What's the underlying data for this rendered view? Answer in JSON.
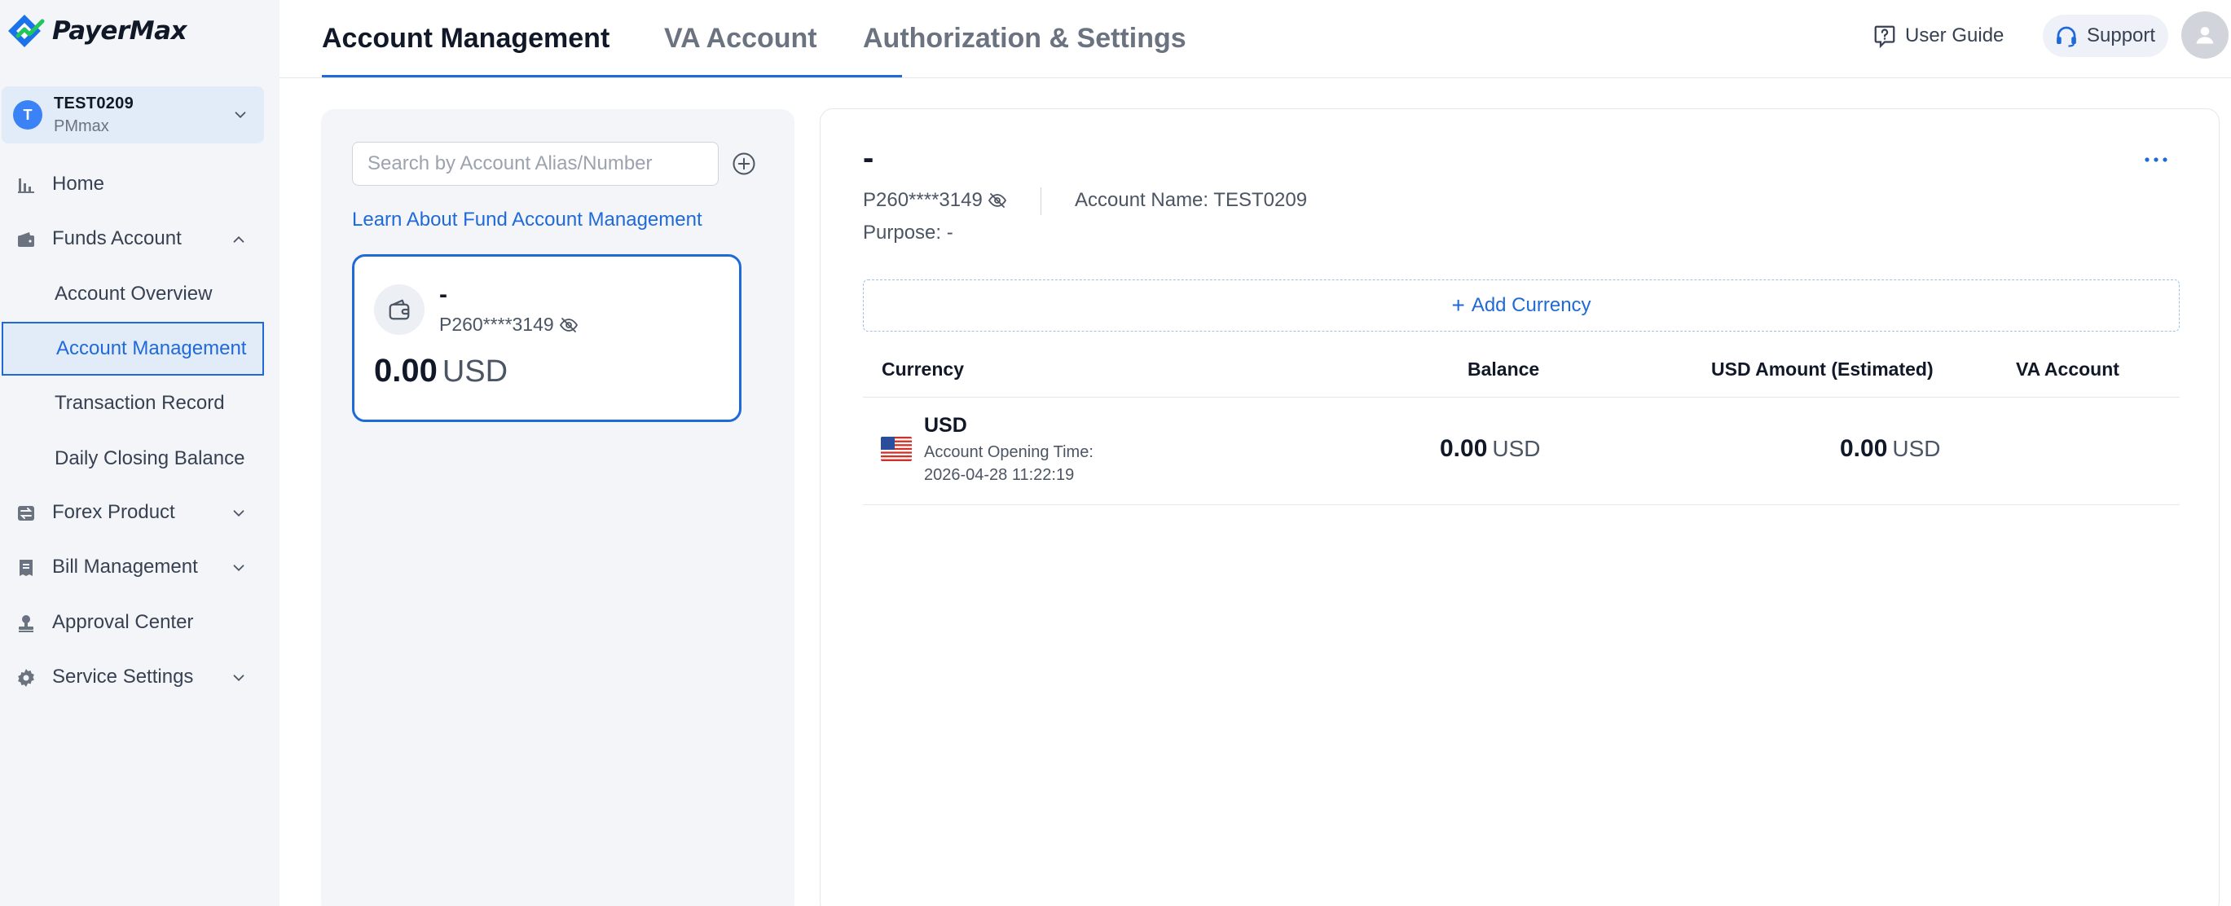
{
  "brand": {
    "name": "PayerMax"
  },
  "merchant": {
    "initial": "T",
    "name": "TEST0209",
    "sub": "PMmax"
  },
  "sidebar": {
    "items": [
      {
        "label": "Home"
      },
      {
        "label": "Funds Account",
        "expanded": true
      },
      {
        "label": "Forex Product"
      },
      {
        "label": "Bill Management"
      },
      {
        "label": "Approval Center"
      },
      {
        "label": "Service Settings"
      }
    ],
    "funds_subitems": [
      {
        "label": "Account Overview"
      },
      {
        "label": "Account Management",
        "active": true
      },
      {
        "label": "Transaction Record"
      },
      {
        "label": "Daily Closing Balance"
      }
    ]
  },
  "header": {
    "tabs": [
      {
        "label": "Account Management",
        "active": true
      },
      {
        "label": "VA Account"
      },
      {
        "label": "Authorization & Settings"
      }
    ],
    "user_guide": "User Guide",
    "support": "Support"
  },
  "left": {
    "search_placeholder": "Search by Account Alias/Number",
    "learn_link": "Learn About Fund Account Management",
    "card": {
      "alias": "-",
      "number": "P260****3149",
      "amount": "0.00",
      "currency": "USD"
    }
  },
  "detail": {
    "title": "-",
    "number": "P260****3149",
    "account_name": "Account Name: TEST0209",
    "purpose": "Purpose: -",
    "add_currency": "Add Currency",
    "table": {
      "headers": [
        "Currency",
        "Balance",
        "USD Amount (Estimated)",
        "VA Account"
      ],
      "rows": [
        {
          "currency": "USD",
          "opening_label": "Account Opening Time:",
          "opening_time": "2026-04-28 11:22:19",
          "balance": "0.00",
          "balance_currency": "USD",
          "usd_amount": "0.00",
          "usd_currency": "USD",
          "va_account": ""
        }
      ]
    }
  },
  "colors": {
    "accent": "#1f6ad8",
    "sidebar_bg": "#f3f5f9",
    "active_bg": "#e2ebf8"
  }
}
